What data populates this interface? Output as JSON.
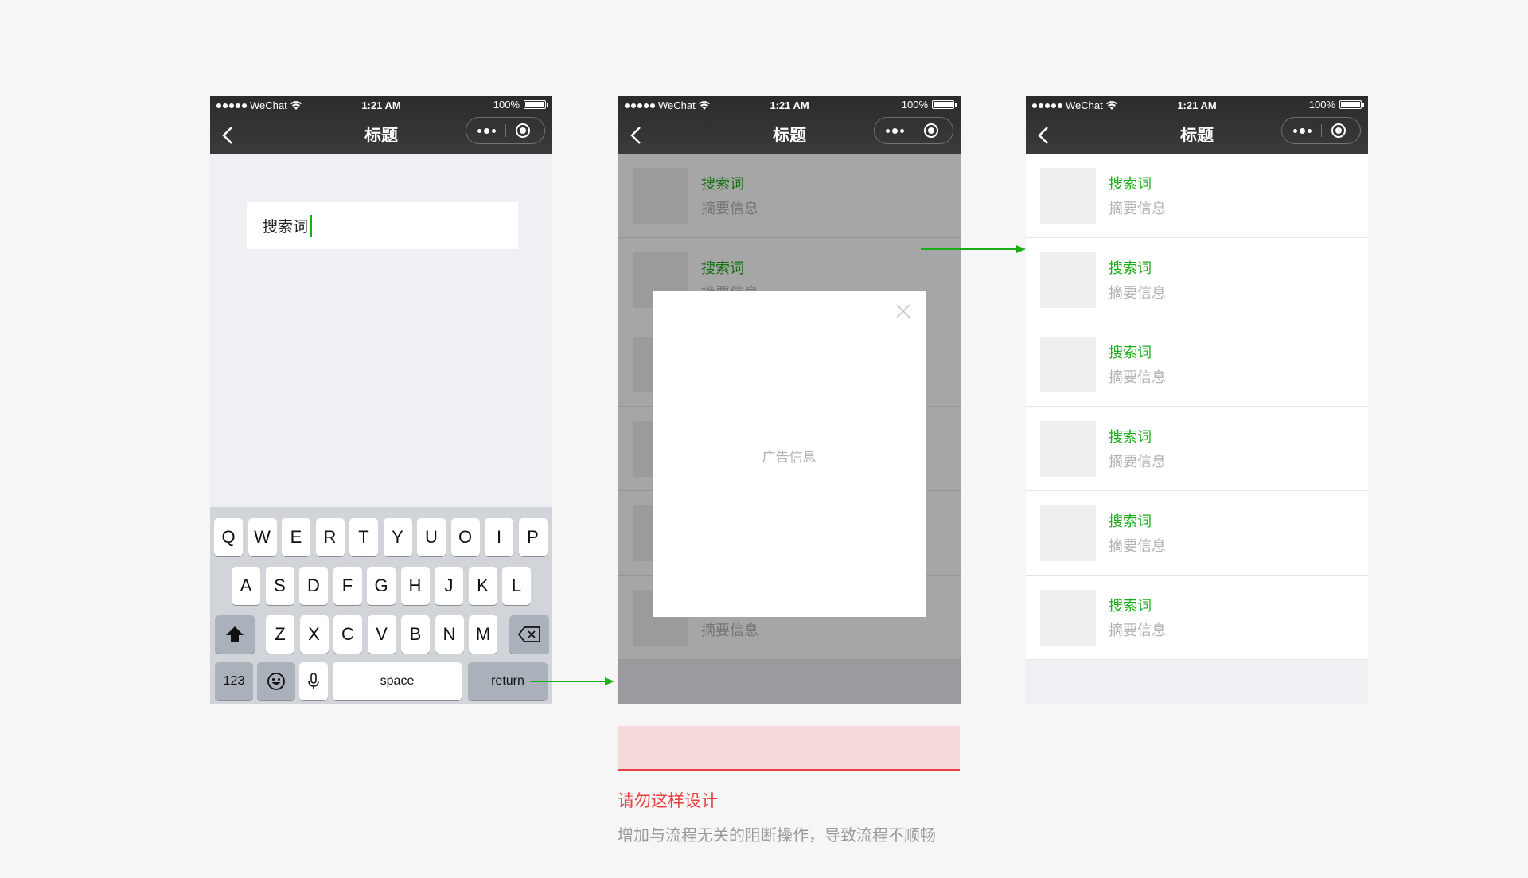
{
  "status": {
    "carrier": "WeChat",
    "time": "1:21 AM",
    "battery": "100%"
  },
  "nav": {
    "title": "标题"
  },
  "search": {
    "value": "搜索词"
  },
  "keyboard": {
    "row1": [
      "Q",
      "W",
      "E",
      "R",
      "T",
      "Y",
      "U",
      "O",
      "I",
      "P"
    ],
    "row2": [
      "A",
      "S",
      "D",
      "F",
      "G",
      "H",
      "J",
      "K",
      "L"
    ],
    "row3": [
      "Z",
      "X",
      "C",
      "V",
      "B",
      "N",
      "M"
    ],
    "numbers_label": "123",
    "space_label": "space",
    "return_label": "return"
  },
  "result_item": {
    "keyword": "搜索词",
    "summary": "摘要信息"
  },
  "modal": {
    "ad_text": "广告信息"
  },
  "warning": {
    "title": "请勿这样设计",
    "description": "增加与流程无关的阻断操作，导致流程不顺畅"
  },
  "colors": {
    "accent": "#1aad19",
    "warning": "#e64340"
  }
}
